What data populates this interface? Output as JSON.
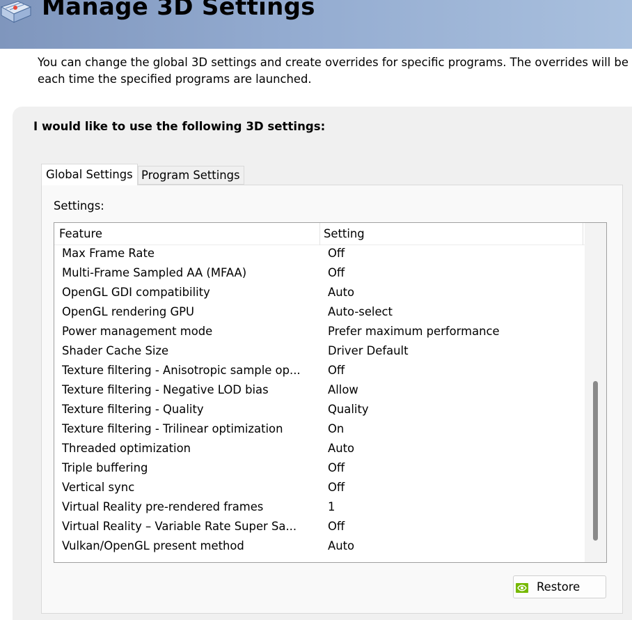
{
  "header": {
    "title": "Manage 3D Settings",
    "colors": {
      "gradient_start": "#7f96bd",
      "gradient_end": "#a9c0de"
    },
    "icon": "3d-settings-icon"
  },
  "intro": {
    "line1": "You can change the global 3D settings and create overrides for specific programs. The overrides will be",
    "line2": "each time the specified programs are launched."
  },
  "panel": {
    "heading": "I would like to use the following 3D settings:"
  },
  "tabs": [
    {
      "label": "Global Settings",
      "selected": true
    },
    {
      "label": "Program Settings",
      "selected": false
    }
  ],
  "settings": {
    "label": "Settings:",
    "columns": {
      "feature": "Feature",
      "setting": "Setting"
    },
    "rows": [
      {
        "feature": "Max Frame Rate",
        "setting": "Off"
      },
      {
        "feature": "Multi-Frame Sampled AA (MFAA)",
        "setting": "Off"
      },
      {
        "feature": "OpenGL GDI compatibility",
        "setting": "Auto"
      },
      {
        "feature": "OpenGL rendering GPU",
        "setting": "Auto-select"
      },
      {
        "feature": "Power management mode",
        "setting": "Prefer maximum performance"
      },
      {
        "feature": "Shader Cache Size",
        "setting": "Driver Default"
      },
      {
        "feature": "Texture filtering - Anisotropic sample op...",
        "setting": "Off"
      },
      {
        "feature": "Texture filtering - Negative LOD bias",
        "setting": "Allow"
      },
      {
        "feature": "Texture filtering - Quality",
        "setting": "Quality"
      },
      {
        "feature": "Texture filtering - Trilinear optimization",
        "setting": "On"
      },
      {
        "feature": "Threaded optimization",
        "setting": "Auto"
      },
      {
        "feature": "Triple buffering",
        "setting": "Off"
      },
      {
        "feature": "Vertical sync",
        "setting": "Off"
      },
      {
        "feature": "Virtual Reality pre-rendered frames",
        "setting": "1"
      },
      {
        "feature": "Virtual Reality – Variable Rate Super Sa...",
        "setting": "Off"
      },
      {
        "feature": "Vulkan/OpenGL present method",
        "setting": "Auto"
      }
    ]
  },
  "restore": {
    "label": "Restore",
    "icon": "nvidia-logo-icon",
    "icon_color": "#76b900"
  }
}
